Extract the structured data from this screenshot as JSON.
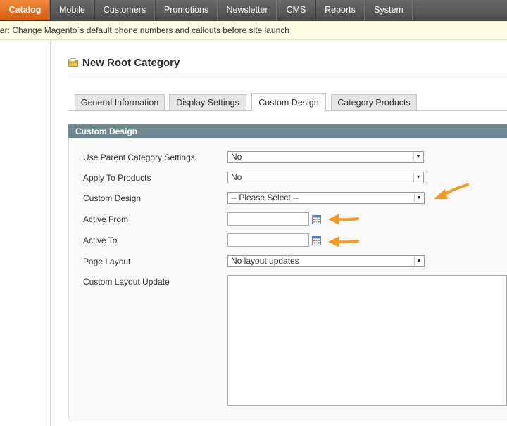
{
  "nav": {
    "items": [
      {
        "label": "Catalog",
        "active": true
      },
      {
        "label": "Mobile"
      },
      {
        "label": "Customers"
      },
      {
        "label": "Promotions"
      },
      {
        "label": "Newsletter"
      },
      {
        "label": "CMS"
      },
      {
        "label": "Reports"
      },
      {
        "label": "System"
      }
    ]
  },
  "message": "er: Change Magento`s default phone numbers and callouts before site launch",
  "page": {
    "title": "New Root Category",
    "icon": "folder-icon"
  },
  "tabs": [
    {
      "label": "General Information"
    },
    {
      "label": "Display Settings"
    },
    {
      "label": "Custom Design",
      "active": true
    },
    {
      "label": "Category Products"
    }
  ],
  "fieldset": {
    "title": "Custom Design"
  },
  "form": {
    "use_parent": {
      "label": "Use Parent Category Settings",
      "value": "No"
    },
    "apply_products": {
      "label": "Apply To Products",
      "value": "No"
    },
    "custom_design": {
      "label": "Custom Design",
      "value": "-- Please Select --"
    },
    "active_from": {
      "label": "Active From",
      "value": ""
    },
    "active_to": {
      "label": "Active To",
      "value": ""
    },
    "page_layout": {
      "label": "Page Layout",
      "value": "No layout updates"
    },
    "layout_update": {
      "label": "Custom Layout Update",
      "value": ""
    }
  },
  "colors": {
    "nav_active": "#e46c1b",
    "fieldset_header": "#6f8992",
    "annotation_arrow": "#f39a22",
    "message_bg": "#fffbe3"
  }
}
